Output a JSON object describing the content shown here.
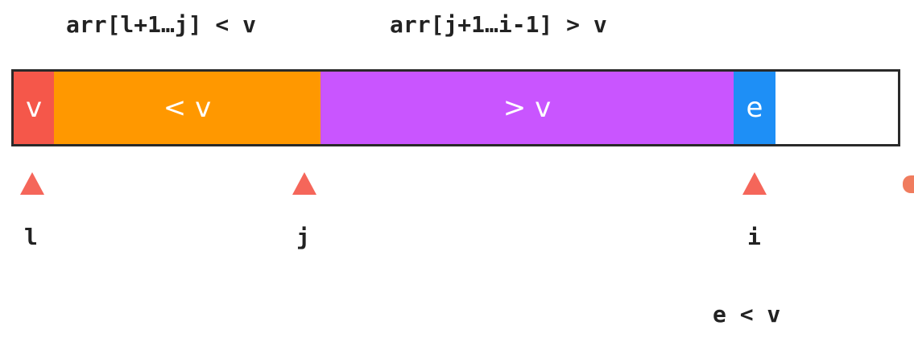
{
  "labels": {
    "range_left": "arr[l+1…j] < v",
    "range_right": "arr[j+1…i-1] > v"
  },
  "segments": [
    {
      "id": "pivot",
      "text": "v",
      "color": "#f5574a"
    },
    {
      "id": "less",
      "text": "< v",
      "color": "#ff9800"
    },
    {
      "id": "greater",
      "text": "> v",
      "color": "#c955ff"
    },
    {
      "id": "current",
      "text": "e",
      "color": "#1e8ff6"
    },
    {
      "id": "unprocessed",
      "text": "",
      "color": "#ffffff"
    }
  ],
  "pointers": {
    "l": "l",
    "j": "j",
    "i": "i"
  },
  "condition": "e < v",
  "colors": {
    "pointer_marker": "#f5665a",
    "text": "#222222",
    "border": "#2a2a2a"
  }
}
